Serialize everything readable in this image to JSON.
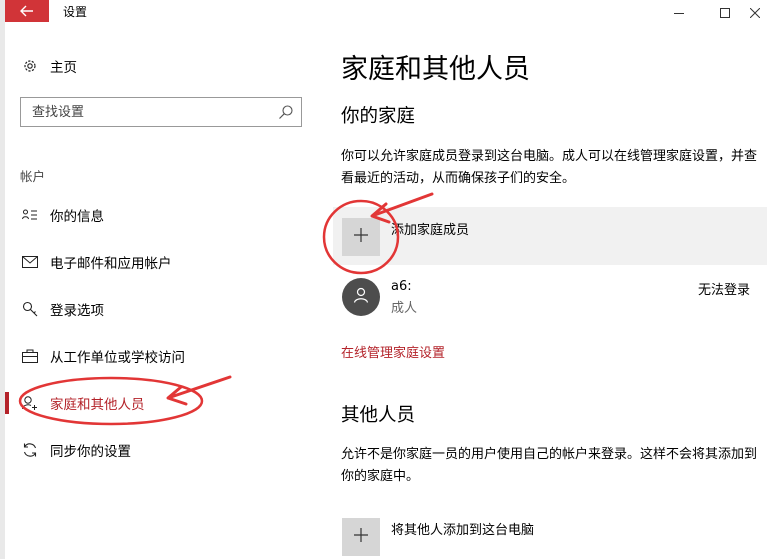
{
  "window": {
    "title": "设置",
    "back_icon": "arrow-left-icon",
    "controls": [
      "minimize-icon",
      "maximize-icon",
      "close-icon"
    ]
  },
  "sidebar": {
    "home": {
      "label": "主页",
      "icon": "gear-icon"
    },
    "search": {
      "placeholder": "查找设置",
      "icon": "search-icon"
    },
    "section_label": "帐户",
    "items": [
      {
        "label": "你的信息",
        "icon": "person-list-icon"
      },
      {
        "label": "电子邮件和应用帐户",
        "icon": "mail-icon"
      },
      {
        "label": "登录选项",
        "icon": "key-icon"
      },
      {
        "label": "从工作单位或学校访问",
        "icon": "briefcase-icon"
      },
      {
        "label": "家庭和其他人员",
        "icon": "add-person-icon",
        "selected": true
      },
      {
        "label": "同步你的设置",
        "icon": "sync-icon"
      }
    ]
  },
  "main": {
    "title": "家庭和其他人员",
    "family": {
      "heading": "你的家庭",
      "description": "你可以允许家庭成员登录到这台电脑。成人可以在线管理家庭设置，并查看最近的活动，从而确保孩子们的安全。",
      "add_label": "添加家庭成员",
      "member": {
        "name": "a6:",
        "role": "成人",
        "status": "无法登录"
      },
      "manage_link": "在线管理家庭设置"
    },
    "others": {
      "heading": "其他人员",
      "description": "允许不是你家庭一员的用户使用自己的帐户来登录。这样不会将其添加到你的家庭中。",
      "add_label": "将其他人添加到这台电脑"
    }
  },
  "colors": {
    "accent": "#b4232a",
    "back_button": "#d13438",
    "annotation": "#e23636",
    "tile": "#d6d6d6",
    "avatar": "#4d4d4d"
  }
}
